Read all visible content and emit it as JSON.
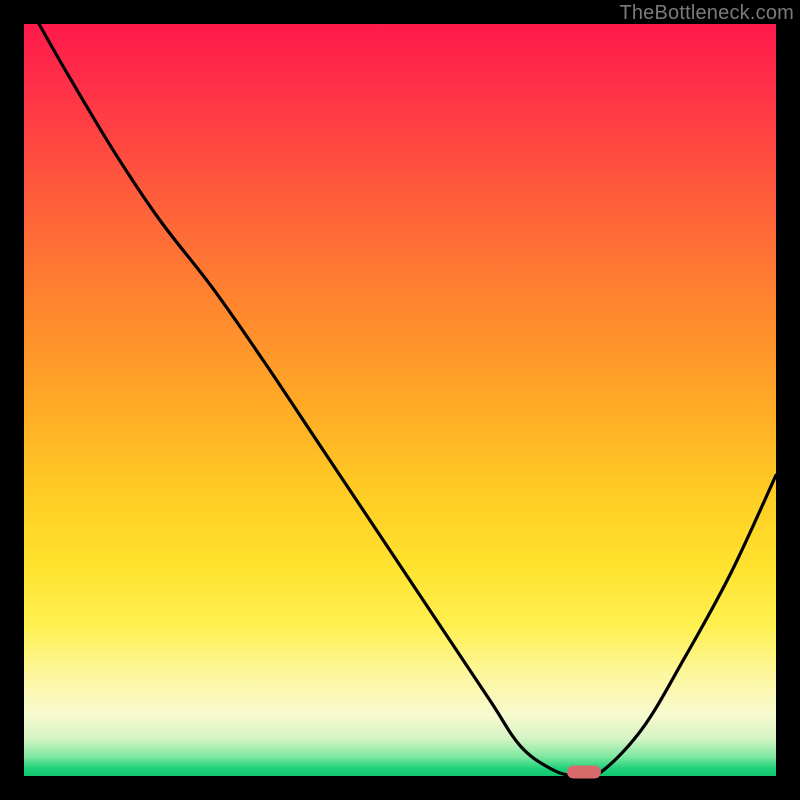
{
  "watermark": "TheBottleneck.com",
  "colors": {
    "background": "#000000",
    "curve": "#000000",
    "marker": "#d96a6b"
  },
  "chart_data": {
    "type": "line",
    "title": "",
    "xlabel": "",
    "ylabel": "",
    "xlim": [
      0,
      100
    ],
    "ylim": [
      0,
      100
    ],
    "grid": false,
    "legend": false,
    "series": [
      {
        "name": "bottleneck-curve",
        "x": [
          2,
          6,
          12,
          18,
          25,
          32,
          40,
          48,
          56,
          62,
          66,
          70,
          73,
          76,
          82,
          88,
          94,
          100
        ],
        "y": [
          100,
          93,
          83,
          74,
          65,
          55,
          43,
          31,
          19,
          10,
          4,
          1,
          0,
          0,
          6,
          16,
          27,
          40
        ]
      }
    ],
    "marker": {
      "x": 74.5,
      "y": 0,
      "shape": "pill"
    },
    "notes": "y = 0 is plot bottom (green), y = 100 is plot top (red). Values are fractions of the plotting area; no numeric axes are shown in the image so values are estimated from curve geometry."
  }
}
